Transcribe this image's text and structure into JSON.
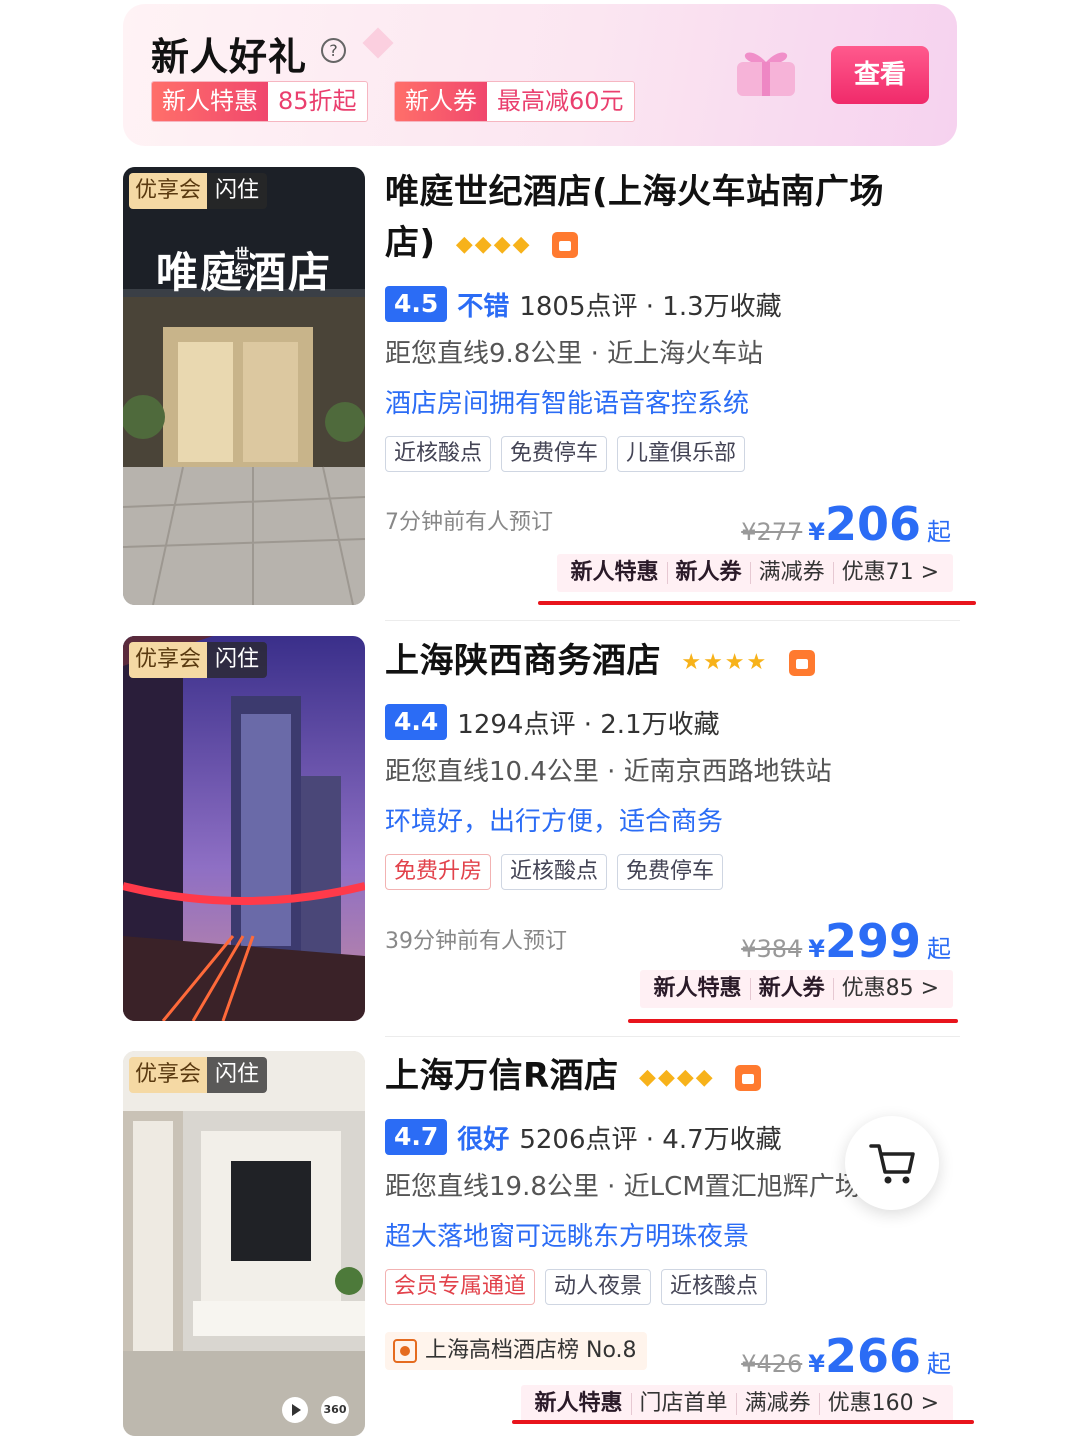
{
  "promo": {
    "title": "新人好礼",
    "help": "?",
    "tags": [
      {
        "key": "新人特惠",
        "value": "85折起"
      },
      {
        "key": "新人券",
        "value": "最高减60元"
      }
    ],
    "button": "查看"
  },
  "hotels": [
    {
      "badge": [
        "优享会",
        "闪住"
      ],
      "image_text": "唯庭酒店",
      "image_small_text": "世纪",
      "title": "唯庭世纪酒店(上海火车站南广场店)",
      "title_line1": "唯庭世纪酒店(上海火车站南广场",
      "title_line2": "店)",
      "stars": "◆◆◆◆",
      "score": "4.5",
      "score_word": "不错",
      "reviews": "1805点评 · 1.3万收藏",
      "distance": "距您直线9.8公里 · 近上海火车站",
      "highlight": "酒店房间拥有智能语音客控系统",
      "tags": [
        "近核酸点",
        "免费停车",
        "儿童俱乐部"
      ],
      "booked": "7分钟前有人预订",
      "original_price": "¥277",
      "currency": "¥",
      "price": "206",
      "price_suffix": "起",
      "promos": [
        "新人特惠",
        "新人券",
        "满减券",
        "优惠71 >"
      ]
    },
    {
      "badge": [
        "优享会",
        "闪住"
      ],
      "title": "上海陕西商务酒店",
      "stars": "★★★★",
      "score": "4.4",
      "reviews": "1294点评 · 2.1万收藏",
      "distance": "距您直线10.4公里 · 近南京西路地铁站",
      "highlight": "环境好，出行方便，适合商务",
      "tags": [
        "免费升房",
        "近核酸点",
        "免费停车"
      ],
      "booked": "39分钟前有人预订",
      "original_price": "¥384",
      "currency": "¥",
      "price": "299",
      "price_suffix": "起",
      "promos": [
        "新人特惠",
        "新人券",
        "优惠85 >"
      ]
    },
    {
      "badge": [
        "优享会",
        "闪住"
      ],
      "title": "上海万信R酒店",
      "stars": "◆◆◆◆",
      "score": "4.7",
      "score_word": "很好",
      "reviews": "5206点评 · 4.7万收藏",
      "distance": "距您直线19.8公里 · 近LCM置汇旭辉广场",
      "highlight": "超大落地窗可远眺东方明珠夜景",
      "tags": [
        "会员专属通道",
        "动人夜景",
        "近核酸点"
      ],
      "rank": "上海高档酒店榜 No.8",
      "original_price": "¥426",
      "currency": "¥",
      "price": "266",
      "price_suffix": "起",
      "promos": [
        "新人特惠",
        "门店首单",
        "满减券",
        "优惠160 >"
      ],
      "media_labels": [
        "360"
      ]
    }
  ],
  "colors": {
    "accent_blue": "#2b6cf5",
    "promo_pink": "#f02a6a",
    "underline_red": "#e8141c",
    "star_gold": "#f7b21a"
  },
  "icons": [
    "help-icon",
    "gift-icon",
    "thumbs-up-icon",
    "play-icon",
    "vr-360-icon",
    "cart-icon",
    "rank-icon"
  ]
}
